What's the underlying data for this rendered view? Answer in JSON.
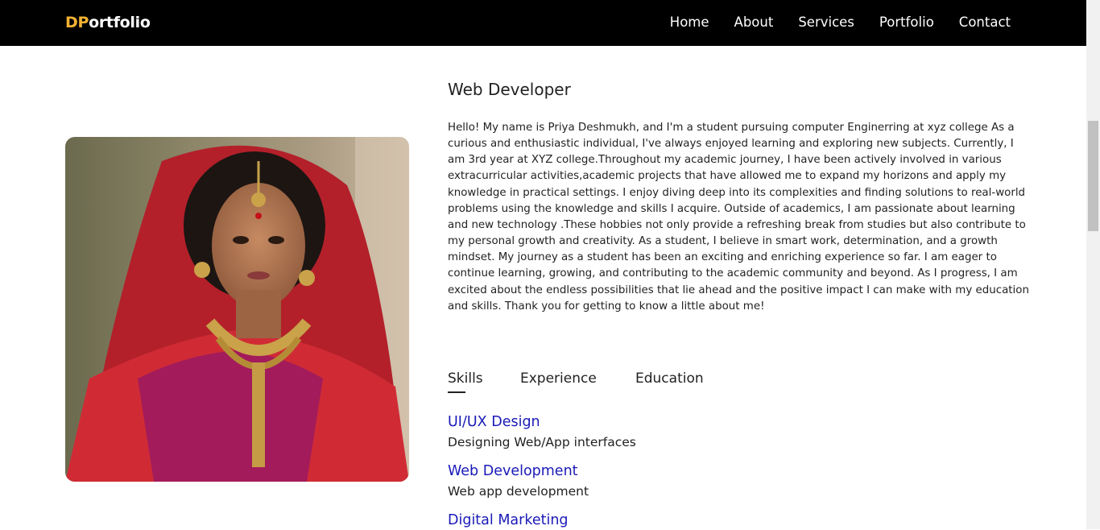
{
  "navbar": {
    "logo_accent": "DP",
    "logo_rest": "ortfolio",
    "links": [
      "Home",
      "About",
      "Services",
      "Portfolio",
      "Contact"
    ]
  },
  "about": {
    "role": "Web Developer",
    "bio": "Hello! My name is Priya Deshmukh, and I'm a student pursuing computer Enginerring at xyz college As a curious and enthusiastic individual, I've always enjoyed learning and exploring new subjects. Currently, I am 3rd year at XYZ college.Throughout my academic journey, I have been actively involved in various extracurricular activities,academic projects that have allowed me to expand my horizons and apply my knowledge in practical settings. I enjoy diving deep into its complexities and finding solutions to real-world problems using the knowledge and skills I acquire. Outside of academics, I am passionate about learning and new technology .These hobbies not only provide a refreshing break from studies but also contribute to my personal growth and creativity. As a student, I believe in smart work, determination, and a growth mindset. My journey as a student has been an exciting and enriching experience so far. I am eager to continue learning, growing, and contributing to the academic community and beyond. As I progress, I am excited about the endless possibilities that lie ahead and the positive impact I can make with my education and skills. Thank you for getting to know a little about me!",
    "tabs": [
      "Skills",
      "Experience",
      "Education"
    ],
    "active_tab": "Skills",
    "skills": [
      {
        "title": "UI/UX Design",
        "desc": "Designing Web/App interfaces"
      },
      {
        "title": "Web Development",
        "desc": "Web app development"
      },
      {
        "title": "Digital Marketing",
        "desc": ""
      }
    ]
  },
  "colors": {
    "nav_bg": "#000000",
    "logo_accent": "#f2b233",
    "skill_title": "#1a1ab8"
  }
}
